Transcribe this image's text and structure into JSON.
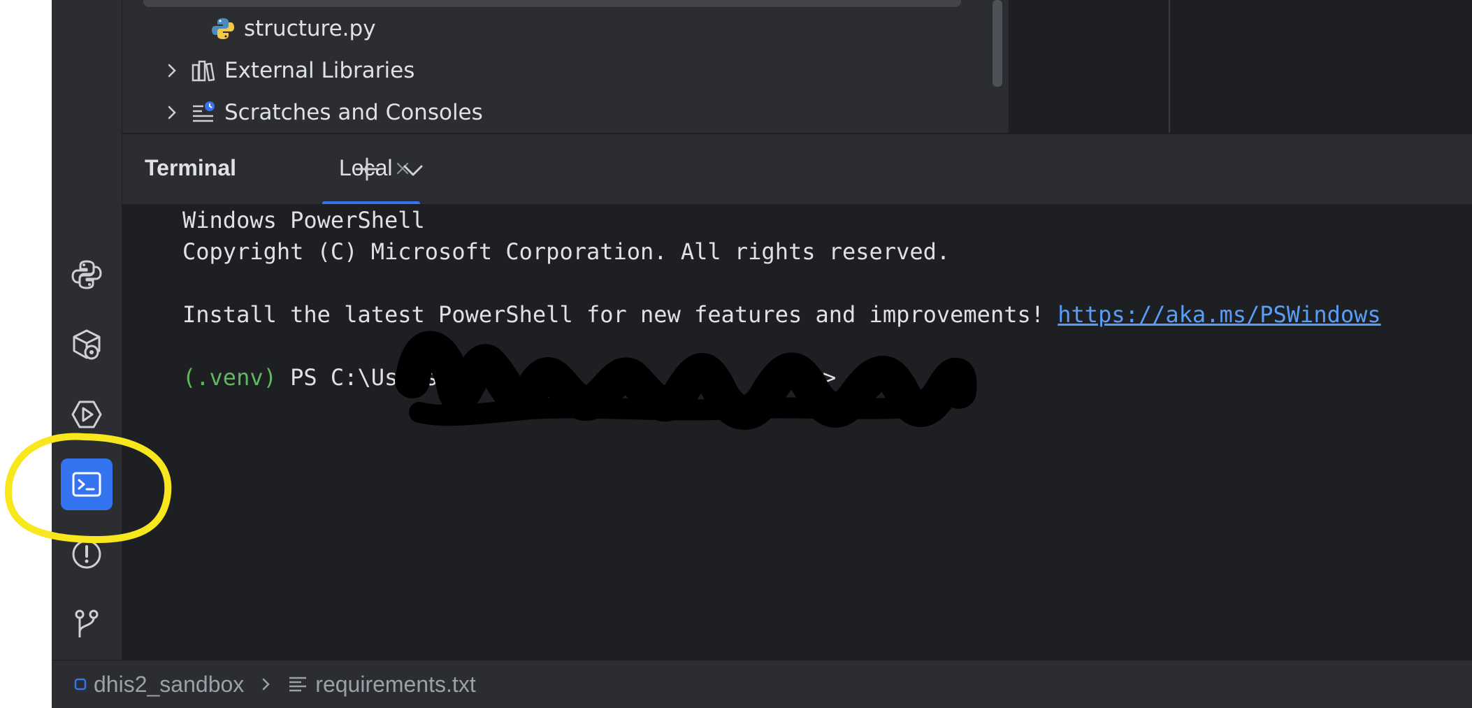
{
  "project_tree": {
    "items": [
      {
        "label": "structure.py",
        "icon": "python-file-icon"
      },
      {
        "label": "External Libraries",
        "icon": "library-icon"
      },
      {
        "label": "Scratches and Consoles",
        "icon": "scratches-icon"
      }
    ]
  },
  "tool_stripe": {
    "items": [
      {
        "name": "python-console",
        "icon": "python-icon"
      },
      {
        "name": "python-packages",
        "icon": "packages-icon"
      },
      {
        "name": "services",
        "icon": "services-run-icon"
      },
      {
        "name": "terminal",
        "icon": "terminal-icon",
        "active": true
      },
      {
        "name": "problems",
        "icon": "problems-icon"
      },
      {
        "name": "git",
        "icon": "git-branch-icon"
      }
    ]
  },
  "terminal": {
    "title": "Terminal",
    "tabs": [
      {
        "label": "Local",
        "active": true
      }
    ],
    "lines": {
      "line1": "Windows PowerShell",
      "line2": "Copyright (C) Microsoft Corporation. All rights reserved.",
      "line3_text": "Install the latest PowerShell for new features and improvements! ",
      "line3_link": "https://aka.ms/PSWindows",
      "prompt_venv": "(.venv)",
      "prompt_path_start": " PS C:\\Users\\",
      "prompt_end": ">"
    }
  },
  "statusbar": {
    "project": "dhis2_sandbox",
    "file": "requirements.txt"
  },
  "colors": {
    "accent": "#3574f0",
    "venv_green": "#5fb85f",
    "link_blue": "#589df6",
    "annotation_yellow": "#f8e71c"
  }
}
